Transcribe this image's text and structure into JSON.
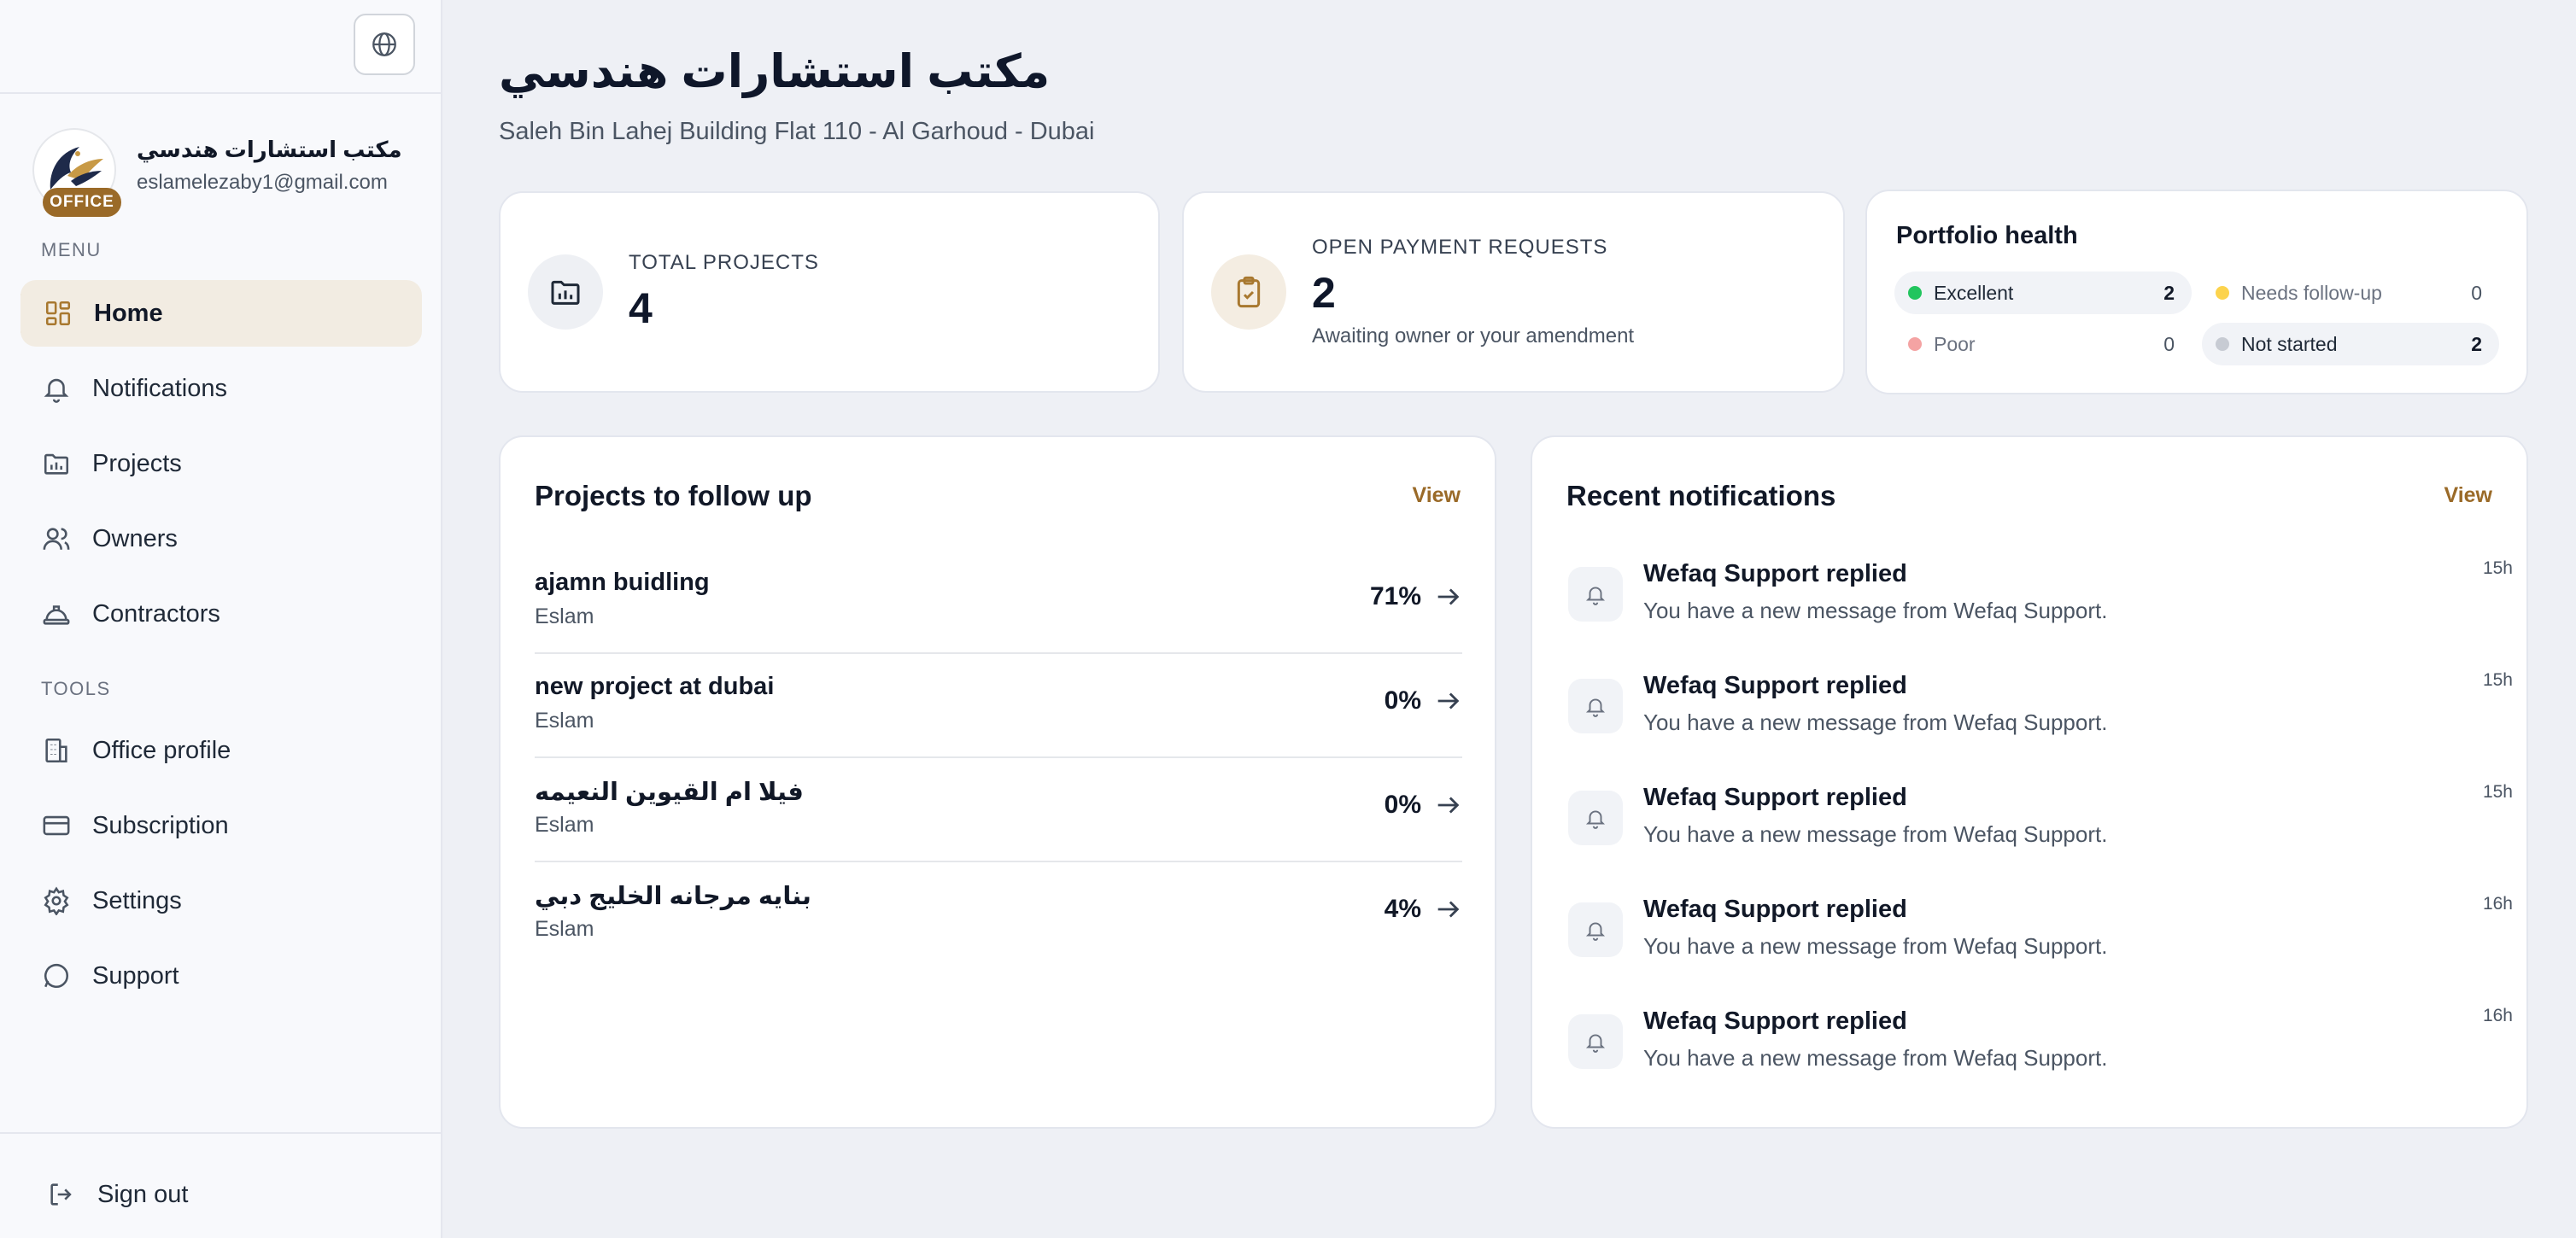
{
  "sidebar": {
    "office_name": "مكتب استشارات هندسي",
    "email": "eslamelezaby1@gmail.com",
    "badge": "OFFICE",
    "menu_label": "MENU",
    "tools_label": "TOOLS",
    "menu": [
      {
        "label": "Home",
        "icon": "dashboard-icon",
        "active": true
      },
      {
        "label": "Notifications",
        "icon": "bell-icon"
      },
      {
        "label": "Projects",
        "icon": "folder-chart-icon"
      },
      {
        "label": "Owners",
        "icon": "users-icon"
      },
      {
        "label": "Contractors",
        "icon": "hard-hat-icon"
      }
    ],
    "tools": [
      {
        "label": "Office profile",
        "icon": "building-icon"
      },
      {
        "label": "Subscription",
        "icon": "credit-card-icon"
      },
      {
        "label": "Settings",
        "icon": "gear-icon"
      },
      {
        "label": "Support",
        "icon": "chat-bubble-icon"
      }
    ],
    "sign_out": "Sign out"
  },
  "header": {
    "title": "مكتب استشارات هندسي",
    "subtitle": "Saleh Bin Lahej Building Flat 110 - Al Garhoud - Dubai"
  },
  "stats": {
    "total_projects": {
      "label": "TOTAL PROJECTS",
      "value": "4"
    },
    "open_payments": {
      "label": "OPEN PAYMENT REQUESTS",
      "value": "2",
      "note": "Awaiting owner or your amendment"
    }
  },
  "portfolio_health": {
    "title": "Portfolio health",
    "items": [
      {
        "name": "Excellent",
        "count": "2",
        "color": "#22c55e"
      },
      {
        "name": "Needs follow-up",
        "count": "0",
        "color": "#fcd34d"
      },
      {
        "name": "Poor",
        "count": "0",
        "color": "#f4a3a3"
      },
      {
        "name": "Not started",
        "count": "2",
        "color": "#c7cbd3"
      }
    ]
  },
  "projects_panel": {
    "title": "Projects to follow up",
    "view_label": "View",
    "rows": [
      {
        "name": "ajamn buidling",
        "owner": "Eslam",
        "progress": "71%"
      },
      {
        "name": "new project at dubai",
        "owner": "Eslam",
        "progress": "0%"
      },
      {
        "name": "فيلا ام القيوين النعيمه",
        "owner": "Eslam",
        "progress": "0%"
      },
      {
        "name": "بنايه مرجانه الخليج دبي",
        "owner": "Eslam",
        "progress": "4%"
      }
    ]
  },
  "notifications_panel": {
    "title": "Recent notifications",
    "view_label": "View",
    "items": [
      {
        "title": "Wefaq Support replied",
        "body": "You have a new message from Wefaq Support.",
        "time": "15h"
      },
      {
        "title": "Wefaq Support replied",
        "body": "You have a new message from Wefaq Support.",
        "time": "15h"
      },
      {
        "title": "Wefaq Support replied",
        "body": "You have a new message from Wefaq Support.",
        "time": "15h"
      },
      {
        "title": "Wefaq Support replied",
        "body": "You have a new message from Wefaq Support.",
        "time": "16h"
      },
      {
        "title": "Wefaq Support replied",
        "body": "You have a new message from Wefaq Support.",
        "time": "16h"
      }
    ]
  },
  "colors": {
    "accent": "#9a6a28",
    "active_bg": "#f2ece2"
  }
}
